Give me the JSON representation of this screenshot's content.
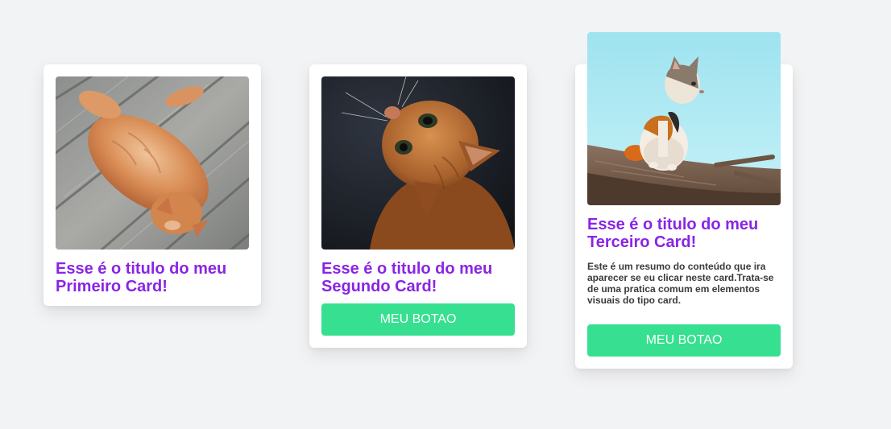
{
  "cards": [
    {
      "title_line1": "Esse é o titulo do meu",
      "title_line2": "Primeiro Card!",
      "image": "orange-cat-lying-on-wooden-deck"
    },
    {
      "title_line1": "Esse é o titulo do meu",
      "title_line2": "Segundo Card!",
      "image": "orange-cat-looking-up",
      "button_label": "MEU BOTAO"
    },
    {
      "title_line1": "Esse é o titulo do meu",
      "title_line2": "Terceiro Card!",
      "image": "calico-kitten-on-branch",
      "description": "Este é um resumo do conteúdo que ira aparecer se eu clicar neste card.Trata-se de uma pratica comum em elementos visuais do tipo card.",
      "button_label": "MEU BOTAO"
    }
  ],
  "colors": {
    "background": "#f2f3f5",
    "card": "#ffffff",
    "title": "#8a24e5",
    "button": "#36e090",
    "button_text": "#ffffff"
  }
}
